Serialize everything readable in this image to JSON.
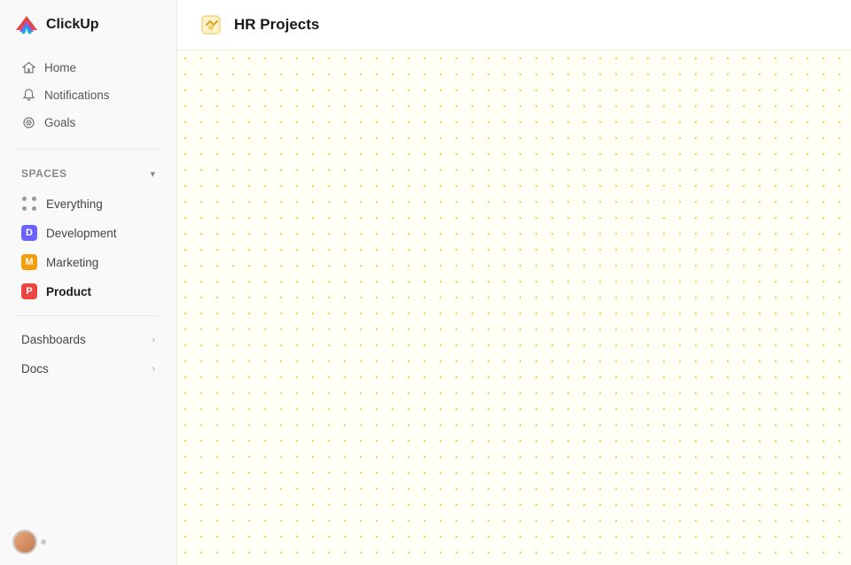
{
  "logo": {
    "text": "ClickUp"
  },
  "nav": {
    "home_label": "Home",
    "notifications_label": "Notifications",
    "goals_label": "Goals"
  },
  "spaces": {
    "label": "Spaces",
    "items": [
      {
        "id": "everything",
        "label": "Everything",
        "type": "dots"
      },
      {
        "id": "development",
        "label": "Development",
        "type": "avatar",
        "color": "#6c63ff",
        "letter": "D"
      },
      {
        "id": "marketing",
        "label": "Marketing",
        "type": "avatar",
        "color": "#f59e0b",
        "letter": "M"
      },
      {
        "id": "product",
        "label": "Product",
        "type": "avatar",
        "color": "#ef4444",
        "letter": "P",
        "active": true
      }
    ]
  },
  "sections": [
    {
      "id": "dashboards",
      "label": "Dashboards"
    },
    {
      "id": "docs",
      "label": "Docs"
    }
  ],
  "header": {
    "title": "HR Projects",
    "icon_color": "#f59e0b"
  }
}
